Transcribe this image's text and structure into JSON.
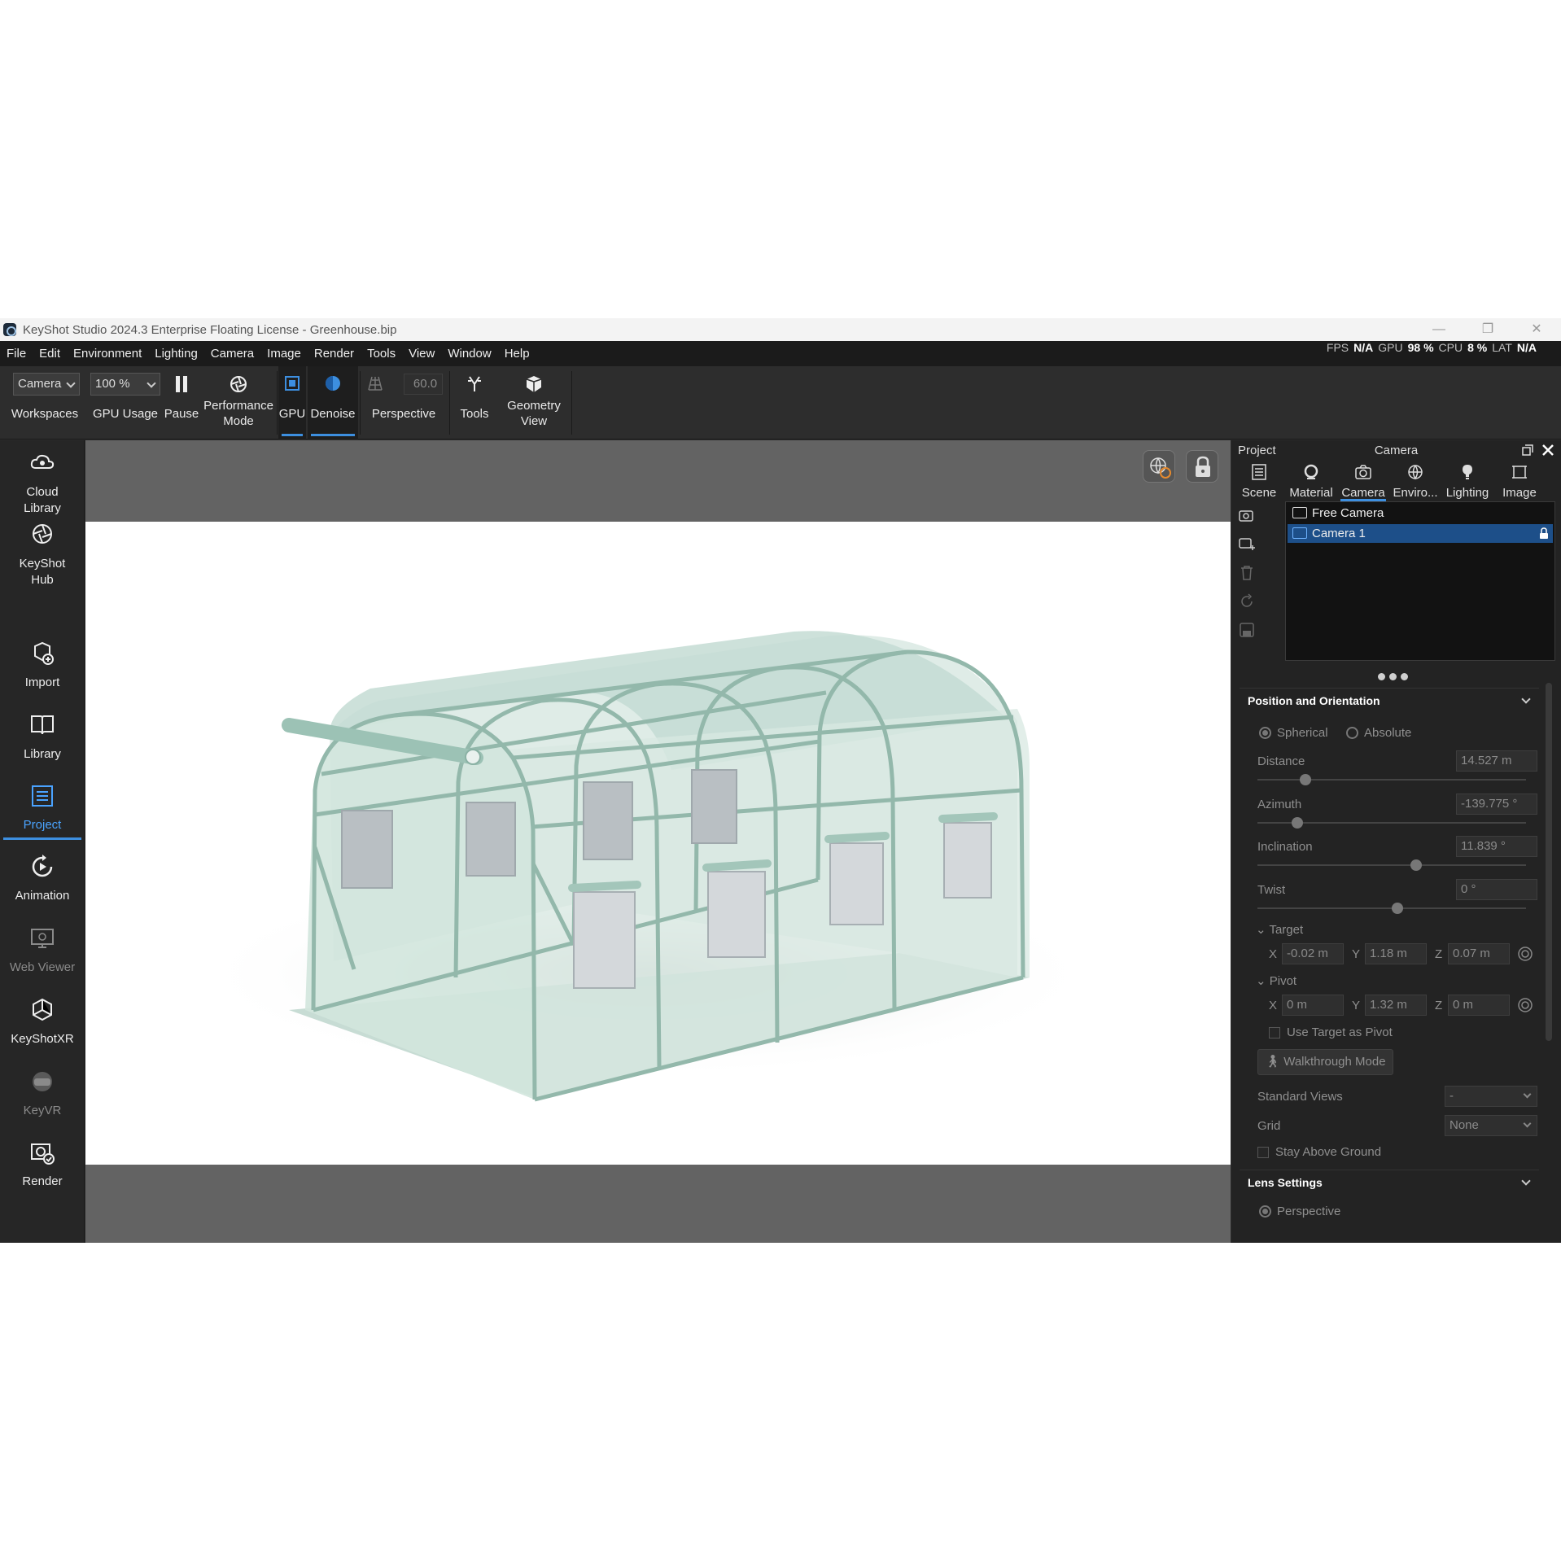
{
  "window": {
    "title": "KeyShot Studio 2024.3 Enterprise Floating License  - Greenhouse.bip"
  },
  "menu": [
    "File",
    "Edit",
    "Environment",
    "Lighting",
    "Camera",
    "Image",
    "Render",
    "Tools",
    "View",
    "Window",
    "Help"
  ],
  "stats": {
    "fps_label": "FPS",
    "fps_value": "N/A",
    "gpu_label": "GPU",
    "gpu_value": "98 %",
    "cpu_label": "CPU",
    "cpu_value": "8 %",
    "lat_label": "LAT",
    "lat_value": "N/A"
  },
  "toolbar": {
    "workspace_value": "Camera",
    "workspaces_label": "Workspaces",
    "gpu_usage_value": "100 %",
    "gpu_usage_label": "GPU Usage",
    "pause_label": "Pause",
    "performance_label": "Performance Mode",
    "gpu_label": "GPU",
    "denoise_label": "Denoise",
    "fov_value": "60.0",
    "perspective_label": "Perspective",
    "tools_label": "Tools",
    "geometry_view_label": "Geometry View"
  },
  "sidebar": [
    {
      "label": "Cloud Library",
      "icon": "cloud-library-icon",
      "state": "normal"
    },
    {
      "label": "KeyShot Hub",
      "icon": "keyshot-hub-icon",
      "state": "normal"
    },
    {
      "label": "Import",
      "icon": "import-icon",
      "state": "normal"
    },
    {
      "label": "Library",
      "icon": "book-icon",
      "state": "normal"
    },
    {
      "label": "Project",
      "icon": "project-icon",
      "state": "active"
    },
    {
      "label": "Animation",
      "icon": "animation-icon",
      "state": "normal"
    },
    {
      "label": "Web Viewer",
      "icon": "web-viewer-icon",
      "state": "disabled"
    },
    {
      "label": "KeyShotXR",
      "icon": "keyshotxr-icon",
      "state": "normal"
    },
    {
      "label": "KeyVR",
      "icon": "vr-headset-icon",
      "state": "disabled"
    },
    {
      "label": "Render",
      "icon": "render-icon",
      "state": "normal"
    }
  ],
  "panel": {
    "project_label": "Project",
    "title": "Camera",
    "tabs": [
      "Scene",
      "Material",
      "Camera",
      "Enviro...",
      "Lighting",
      "Image"
    ],
    "active_tab": "Camera",
    "cameras": [
      "Free Camera",
      "Camera 1"
    ],
    "selected_camera": "Camera 1",
    "position": {
      "title": "Position and Orientation",
      "mode_spherical": "Spherical",
      "mode_absolute": "Absolute",
      "distance_label": "Distance",
      "distance_value": "14.527 m",
      "azimuth_label": "Azimuth",
      "azimuth_value": "-139.775 °",
      "inclination_label": "Inclination",
      "inclination_value": "11.839 °",
      "twist_label": "Twist",
      "twist_value": "0 °",
      "target_label": "Target",
      "target_x": "-0.02 m",
      "target_y": "1.18 m",
      "target_z": "0.07 m",
      "pivot_label": "Pivot",
      "pivot_x": "0 m",
      "pivot_y": "1.32 m",
      "pivot_z": "0 m",
      "axis_x": "X",
      "axis_y": "Y",
      "axis_z": "Z",
      "use_target_label": "Use Target as Pivot",
      "walkthrough_label": "Walkthrough Mode",
      "standard_views_label": "Standard Views",
      "standard_views_value": "-",
      "grid_label": "Grid",
      "grid_value": "None",
      "stay_above_label": "Stay Above Ground"
    },
    "lens": {
      "title": "Lens Settings",
      "perspective_label": "Perspective"
    }
  },
  "colors": {
    "accent": "#3d8fe0",
    "selection": "#1d4f89",
    "greenhouse_frame": "#93b8ab",
    "greenhouse_film": "#cfe3dc"
  }
}
